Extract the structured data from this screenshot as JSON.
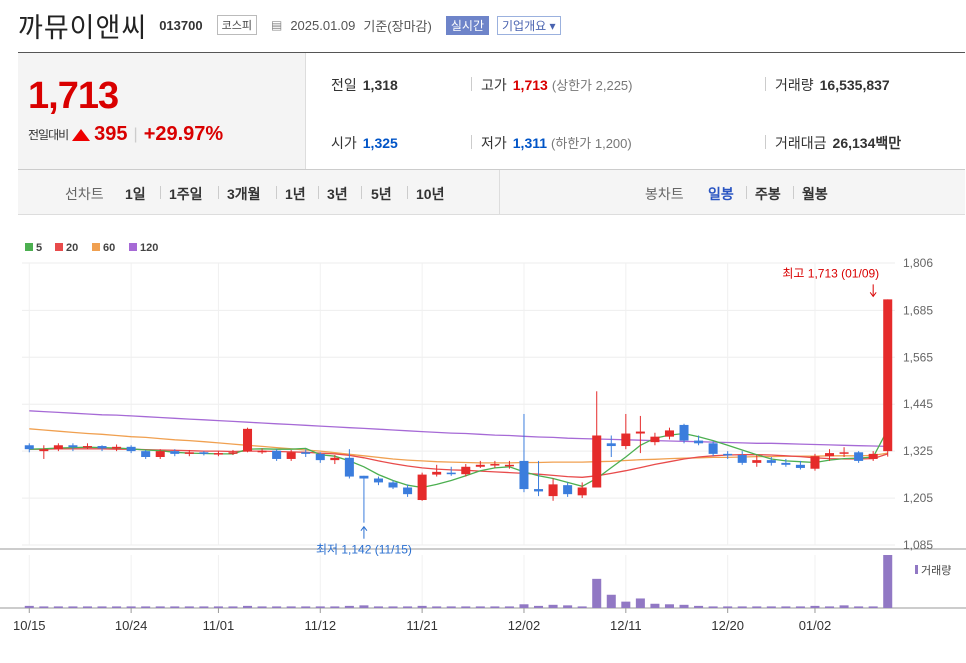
{
  "header": {
    "company_name": "까뮤이앤씨",
    "code": "013700",
    "market": "코스피",
    "date": "2025.01.09",
    "basis": "기준(장마감)",
    "realtime_label": "실시간",
    "overview_label": "기업개요"
  },
  "quote": {
    "price": "1,713",
    "change_label": "전일대비",
    "change": "395",
    "change_pct": "+29.97%",
    "prev_close_label": "전일",
    "prev_close": "1,318",
    "high_label": "고가",
    "high": "1,713",
    "upper_limit": "(상한가 2,225)",
    "volume_label": "거래량",
    "volume": "16,535,837",
    "open_label": "시가",
    "open": "1,325",
    "low_label": "저가",
    "low": "1,311",
    "lower_limit": "(하한가 1,200)",
    "value_label": "거래대금",
    "value": "26,134",
    "value_unit": "백만"
  },
  "periods": {
    "line_label": "선차트",
    "line_items": [
      "1일",
      "1주일",
      "3개월",
      "1년",
      "3년",
      "5년",
      "10년"
    ],
    "candle_label": "봉차트",
    "candle_items": [
      "일봉",
      "주봉",
      "월봉"
    ],
    "selected_candle": "일봉"
  },
  "colors": {
    "up": "#e52b2b",
    "down": "#3b7ddd",
    "ma5": "#4caf50",
    "ma20": "#e84b4b",
    "ma60": "#f0a050",
    "ma120": "#a66ad6",
    "volume": "#9178c4"
  },
  "chart_data": {
    "type": "candlestick",
    "legend": [
      {
        "label": "5",
        "color": "#4caf50"
      },
      {
        "label": "20",
        "color": "#e84b4b"
      },
      {
        "label": "60",
        "color": "#f0a050"
      },
      {
        "label": "120",
        "color": "#a66ad6"
      }
    ],
    "volume_label": "거래량",
    "y_ticks": [
      "1,806",
      "1,685",
      "1,565",
      "1,445",
      "1,325",
      "1,205",
      "1,085"
    ],
    "y_tick_values": [
      1806,
      1685,
      1565,
      1445,
      1325,
      1205,
      1085
    ],
    "ylim": [
      1085,
      1806
    ],
    "x_ticks": [
      {
        "label": "10/15",
        "index": 0
      },
      {
        "label": "10/24",
        "index": 7
      },
      {
        "label": "11/01",
        "index": 13
      },
      {
        "label": "11/12",
        "index": 20
      },
      {
        "label": "11/21",
        "index": 27
      },
      {
        "label": "12/02",
        "index": 34
      },
      {
        "label": "12/11",
        "index": 41
      },
      {
        "label": "12/20",
        "index": 48
      },
      {
        "label": "01/02",
        "index": 54
      }
    ],
    "high_annotation": "최고 1,713 (01/09)",
    "high_index": 58,
    "high_value": 1713,
    "low_annotation": "최저 1,142 (11/15)",
    "low_index": 23,
    "low_value": 1142,
    "candles": [
      [
        1340,
        1330,
        1345,
        1322
      ],
      [
        1325,
        1330,
        1340,
        1305
      ],
      [
        1330,
        1340,
        1345,
        1325
      ],
      [
        1340,
        1335,
        1345,
        1325
      ],
      [
        1335,
        1338,
        1345,
        1330
      ],
      [
        1338,
        1332,
        1340,
        1325
      ],
      [
        1332,
        1336,
        1342,
        1325
      ],
      [
        1336,
        1325,
        1340,
        1320
      ],
      [
        1325,
        1310,
        1328,
        1305
      ],
      [
        1310,
        1325,
        1330,
        1305
      ],
      [
        1325,
        1318,
        1330,
        1312
      ],
      [
        1318,
        1322,
        1328,
        1312
      ],
      [
        1322,
        1318,
        1325,
        1314
      ],
      [
        1318,
        1320,
        1325,
        1312
      ],
      [
        1320,
        1322,
        1328,
        1315
      ],
      [
        1325,
        1382,
        1385,
        1322
      ],
      [
        1322,
        1326,
        1332,
        1318
      ],
      [
        1326,
        1305,
        1330,
        1300
      ],
      [
        1305,
        1322,
        1328,
        1300
      ],
      [
        1322,
        1318,
        1330,
        1310
      ],
      [
        1318,
        1302,
        1322,
        1295
      ],
      [
        1302,
        1308,
        1315,
        1292
      ],
      [
        1308,
        1260,
        1330,
        1255
      ],
      [
        1262,
        1255,
        1262,
        1142
      ],
      [
        1255,
        1245,
        1260,
        1238
      ],
      [
        1245,
        1232,
        1250,
        1228
      ],
      [
        1232,
        1215,
        1240,
        1208
      ],
      [
        1200,
        1265,
        1270,
        1198
      ],
      [
        1265,
        1272,
        1290,
        1260
      ],
      [
        1270,
        1266,
        1285,
        1262
      ],
      [
        1266,
        1285,
        1292,
        1260
      ],
      [
        1285,
        1290,
        1300,
        1282
      ],
      [
        1290,
        1292,
        1300,
        1282
      ],
      [
        1290,
        1290,
        1300,
        1280
      ],
      [
        1300,
        1228,
        1420,
        1220
      ],
      [
        1228,
        1222,
        1300,
        1210
      ],
      [
        1210,
        1240,
        1255,
        1198
      ],
      [
        1238,
        1215,
        1245,
        1208
      ],
      [
        1212,
        1232,
        1245,
        1205
      ],
      [
        1232,
        1365,
        1478,
        1330
      ],
      [
        1345,
        1338,
        1365,
        1310
      ],
      [
        1338,
        1370,
        1420,
        1330
      ],
      [
        1370,
        1375,
        1415,
        1320
      ],
      [
        1348,
        1362,
        1372,
        1340
      ],
      [
        1362,
        1378,
        1385,
        1355
      ],
      [
        1392,
        1352,
        1395,
        1345
      ],
      [
        1352,
        1345,
        1365,
        1340
      ],
      [
        1345,
        1318,
        1350,
        1312
      ],
      [
        1318,
        1315,
        1325,
        1305
      ],
      [
        1315,
        1295,
        1325,
        1290
      ],
      [
        1295,
        1302,
        1315,
        1285
      ],
      [
        1302,
        1295,
        1310,
        1288
      ],
      [
        1295,
        1290,
        1305,
        1285
      ],
      [
        1290,
        1282,
        1300,
        1278
      ],
      [
        1280,
        1312,
        1318,
        1275
      ],
      [
        1312,
        1320,
        1330,
        1300
      ],
      [
        1320,
        1322,
        1335,
        1310
      ],
      [
        1322,
        1300,
        1325,
        1295
      ],
      [
        1305,
        1318,
        1325,
        1300
      ],
      [
        1325,
        1713,
        1713,
        1311
      ]
    ],
    "ma5": [
      1330,
      1331,
      1333,
      1334,
      1335,
      1334,
      1333,
      1331,
      1328,
      1326,
      1322,
      1320,
      1319,
      1318,
      1318,
      1330,
      1331,
      1330,
      1330,
      1332,
      1316,
      1312,
      1300,
      1285,
      1265,
      1250,
      1238,
      1232,
      1240,
      1250,
      1262,
      1275,
      1282,
      1285,
      1272,
      1262,
      1255,
      1245,
      1235,
      1255,
      1283,
      1310,
      1340,
      1358,
      1366,
      1370,
      1362,
      1352,
      1340,
      1328,
      1316,
      1305,
      1300,
      1298,
      1296,
      1302,
      1306,
      1307,
      1310,
      1380
    ],
    "ma20": [
      1330,
      1330,
      1331,
      1331,
      1331,
      1331,
      1330,
      1330,
      1329,
      1328,
      1327,
      1326,
      1325,
      1325,
      1324,
      1325,
      1325,
      1324,
      1323,
      1322,
      1320,
      1318,
      1314,
      1308,
      1300,
      1293,
      1287,
      1282,
      1279,
      1277,
      1276,
      1274,
      1272,
      1270,
      1268,
      1266,
      1263,
      1260,
      1258,
      1262,
      1268,
      1275,
      1283,
      1291,
      1298,
      1305,
      1310,
      1313,
      1315,
      1316,
      1316,
      1315,
      1313,
      1311,
      1308,
      1306,
      1305,
      1305,
      1306,
      1318
    ],
    "ma60": [
      1382,
      1379,
      1376,
      1373,
      1370,
      1368,
      1365,
      1362,
      1360,
      1357,
      1354,
      1352,
      1349,
      1346,
      1343,
      1340,
      1337,
      1334,
      1331,
      1328,
      1325,
      1321,
      1317,
      1313,
      1309,
      1305,
      1302,
      1300,
      1298,
      1297,
      1296,
      1295,
      1295,
      1295,
      1296,
      1296,
      1297,
      1297,
      1297,
      1298,
      1299,
      1301,
      1303,
      1304,
      1306,
      1307,
      1308,
      1309,
      1309,
      1310,
      1311,
      1311,
      1312,
      1312,
      1312,
      1313,
      1313,
      1313,
      1314,
      1320
    ],
    "ma120": [
      1428,
      1426,
      1424,
      1422,
      1420,
      1418,
      1417,
      1415,
      1413,
      1411,
      1409,
      1407,
      1405,
      1403,
      1401,
      1399,
      1397,
      1395,
      1393,
      1391,
      1389,
      1387,
      1385,
      1383,
      1381,
      1379,
      1377,
      1375,
      1373,
      1371,
      1370,
      1368,
      1366,
      1365,
      1363,
      1361,
      1360,
      1358,
      1357,
      1356,
      1355,
      1354,
      1353,
      1352,
      1351,
      1350,
      1349,
      1348,
      1347,
      1346,
      1345,
      1345,
      1344,
      1343,
      1342,
      1341,
      1340,
      1339,
      1338,
      1337
    ],
    "volume": [
      0.04,
      0.03,
      0.03,
      0.03,
      0.03,
      0.03,
      0.03,
      0.03,
      0.03,
      0.03,
      0.03,
      0.03,
      0.03,
      0.03,
      0.03,
      0.04,
      0.03,
      0.03,
      0.03,
      0.03,
      0.03,
      0.03,
      0.04,
      0.05,
      0.03,
      0.03,
      0.03,
      0.04,
      0.03,
      0.03,
      0.03,
      0.03,
      0.03,
      0.03,
      0.07,
      0.04,
      0.06,
      0.05,
      0.03,
      0.55,
      0.25,
      0.12,
      0.18,
      0.08,
      0.07,
      0.06,
      0.04,
      0.03,
      0.03,
      0.03,
      0.03,
      0.03,
      0.03,
      0.03,
      0.04,
      0.03,
      0.05,
      0.03,
      0.03,
      1.0
    ]
  }
}
